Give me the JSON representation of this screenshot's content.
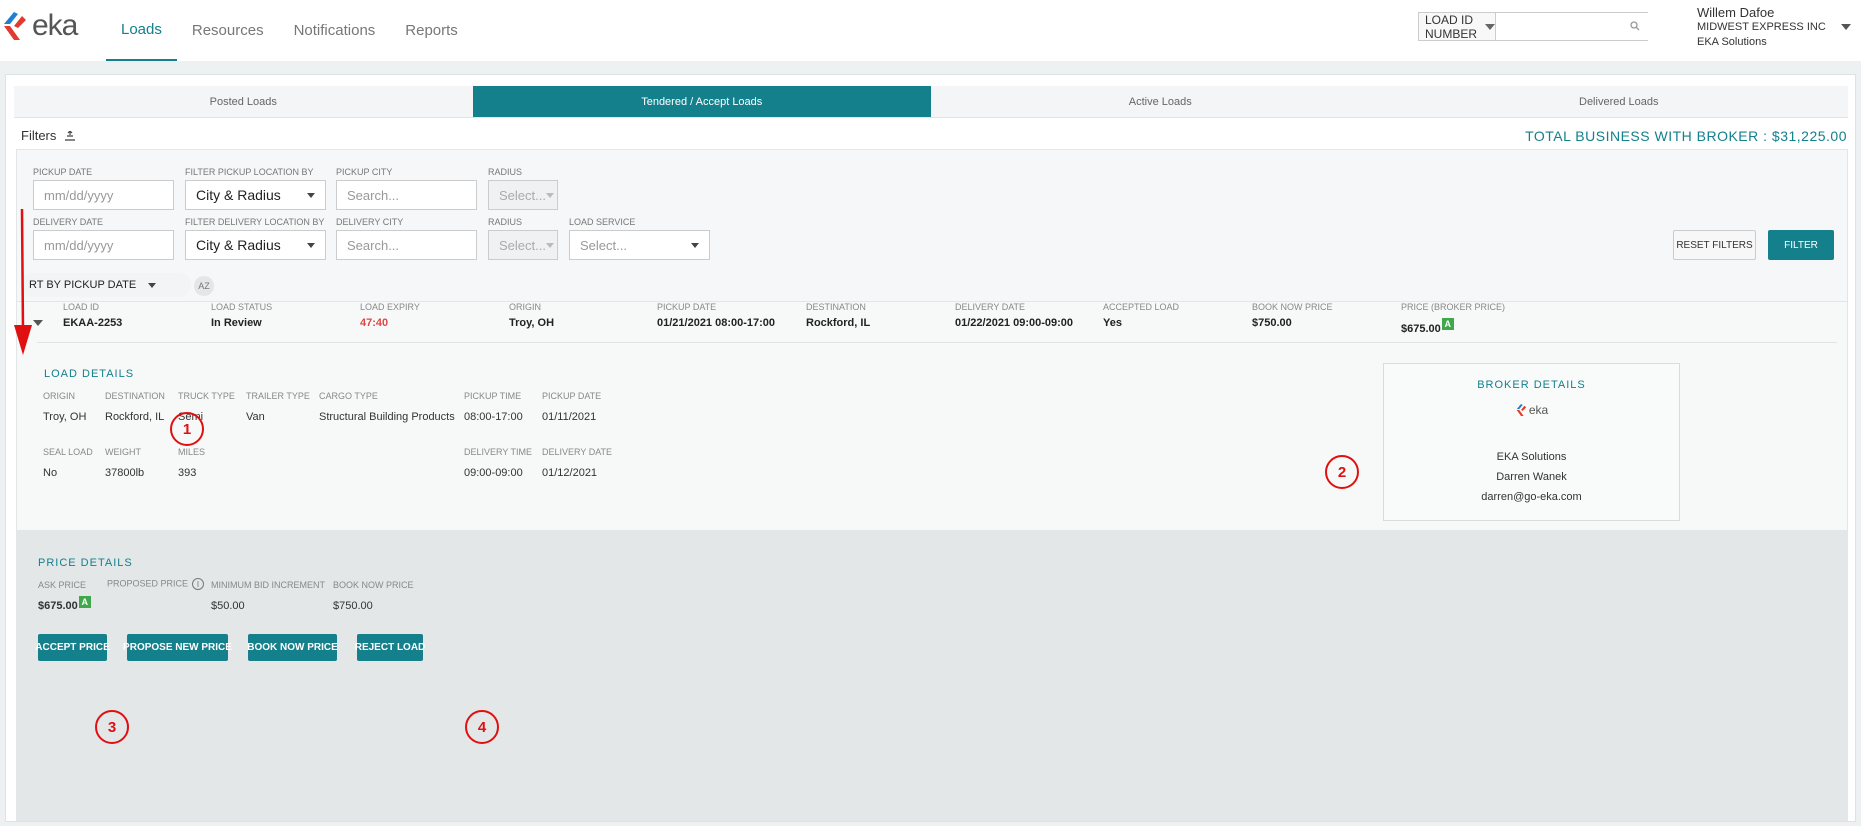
{
  "brand": {
    "logo_text": "eka",
    "accent": "#13808c",
    "logo_colors": [
      "#1d7fd0",
      "#e23a2e"
    ]
  },
  "nav": [
    {
      "label": "Loads",
      "active": true
    },
    {
      "label": "Resources",
      "active": false
    },
    {
      "label": "Notifications",
      "active": false
    },
    {
      "label": "Reports",
      "active": false
    }
  ],
  "search": {
    "type_label": "LOAD ID NUMBER",
    "placeholder": ""
  },
  "user": {
    "name": "Willem Dafoe",
    "company": "MIDWEST EXPRESS INC",
    "org": "EKA Solutions"
  },
  "tabs": [
    {
      "label": "Posted Loads",
      "active": false
    },
    {
      "label": "Tendered / Accept Loads",
      "active": true
    },
    {
      "label": "Active Loads",
      "active": false
    },
    {
      "label": "Delivered Loads",
      "active": false
    }
  ],
  "filters": {
    "title": "Filters",
    "total_business": "TOTAL BUSINESS WITH BROKER : $31,225.00",
    "pickup_date": {
      "label": "PICKUP DATE",
      "placeholder": "mm/dd/yyyy"
    },
    "pickup_location_by": {
      "label": "FILTER PICKUP LOCATION BY",
      "value": "City & Radius"
    },
    "pickup_city": {
      "label": "PICKUP CITY",
      "placeholder": "Search..."
    },
    "pickup_radius": {
      "label": "RADIUS",
      "placeholder": "Select..."
    },
    "delivery_date": {
      "label": "DELIVERY DATE",
      "placeholder": "mm/dd/yyyy"
    },
    "delivery_location_by": {
      "label": "FILTER DELIVERY LOCATION BY",
      "value": "City & Radius"
    },
    "delivery_city": {
      "label": "DELIVERY CITY",
      "placeholder": "Search..."
    },
    "delivery_radius": {
      "label": "RADIUS",
      "placeholder": "Select..."
    },
    "load_service": {
      "label": "LOAD SERVICE",
      "placeholder": "Select..."
    },
    "reset_label": "RESET FILTERS",
    "filter_label": "FILTER"
  },
  "sort": {
    "label": "RT BY PICKUP DATE",
    "az_label": "AZ"
  },
  "load_row": {
    "headers": [
      "LOAD ID",
      "LOAD STATUS",
      "LOAD EXPIRY",
      "ORIGIN",
      "PICKUP DATE",
      "DESTINATION",
      "DELIVERY DATE",
      "ACCEPTED LOAD",
      "BOOK NOW PRICE",
      "PRICE (BROKER PRICE)"
    ],
    "values": [
      "EKAA-2253",
      "In Review",
      "47:40",
      "Troy, OH",
      "01/21/2021 08:00-17:00",
      "Rockford, IL",
      "01/22/2021 09:00-09:00",
      "Yes",
      "$750.00",
      "$675.00"
    ],
    "price_badge": "A",
    "expiry_color": "#e04545"
  },
  "load_details": {
    "title": "LOAD DETAILS",
    "row1": [
      {
        "label": "ORIGIN",
        "value": "Troy, OH"
      },
      {
        "label": "DESTINATION",
        "value": "Rockford, IL"
      },
      {
        "label": "TRUCK TYPE",
        "value": "Semi"
      },
      {
        "label": "TRAILER TYPE",
        "value": "Van"
      },
      {
        "label": "CARGO TYPE",
        "value": "Structural Building Products"
      },
      {
        "label": "PICKUP TIME",
        "value": "08:00-17:00"
      },
      {
        "label": "PICKUP DATE",
        "value": "01/11/2021"
      }
    ],
    "row2": [
      {
        "label": "SEAL LOAD",
        "value": "No"
      },
      {
        "label": "WEIGHT",
        "value": "37800lb"
      },
      {
        "label": "MILES",
        "value": "393"
      },
      {
        "label": "DELIVERY TIME",
        "value": "09:00-09:00"
      },
      {
        "label": "DELIVERY DATE",
        "value": "01/12/2021"
      }
    ]
  },
  "broker": {
    "title": "BROKER DETAILS",
    "logo_text": "eka",
    "company": "EKA Solutions",
    "contact": "Darren Wanek",
    "email": "darren@go-eka.com"
  },
  "price_details": {
    "title": "PRICE DETAILS",
    "ask_label": "ASK PRICE",
    "ask_value": "$675.00",
    "ask_badge": "A",
    "proposed_label": "PROPOSED PRICE",
    "min_bid_label": "MINIMUM BID INCREMENT",
    "min_bid_value": "$50.00",
    "book_now_label": "BOOK NOW PRICE",
    "book_now_value": "$750.00",
    "buttons": [
      "ACCEPT PRICE",
      "PROPOSE NEW PRICE",
      "BOOK NOW PRICE",
      "REJECT LOAD"
    ]
  },
  "annotations": [
    "1",
    "2",
    "3",
    "4"
  ]
}
